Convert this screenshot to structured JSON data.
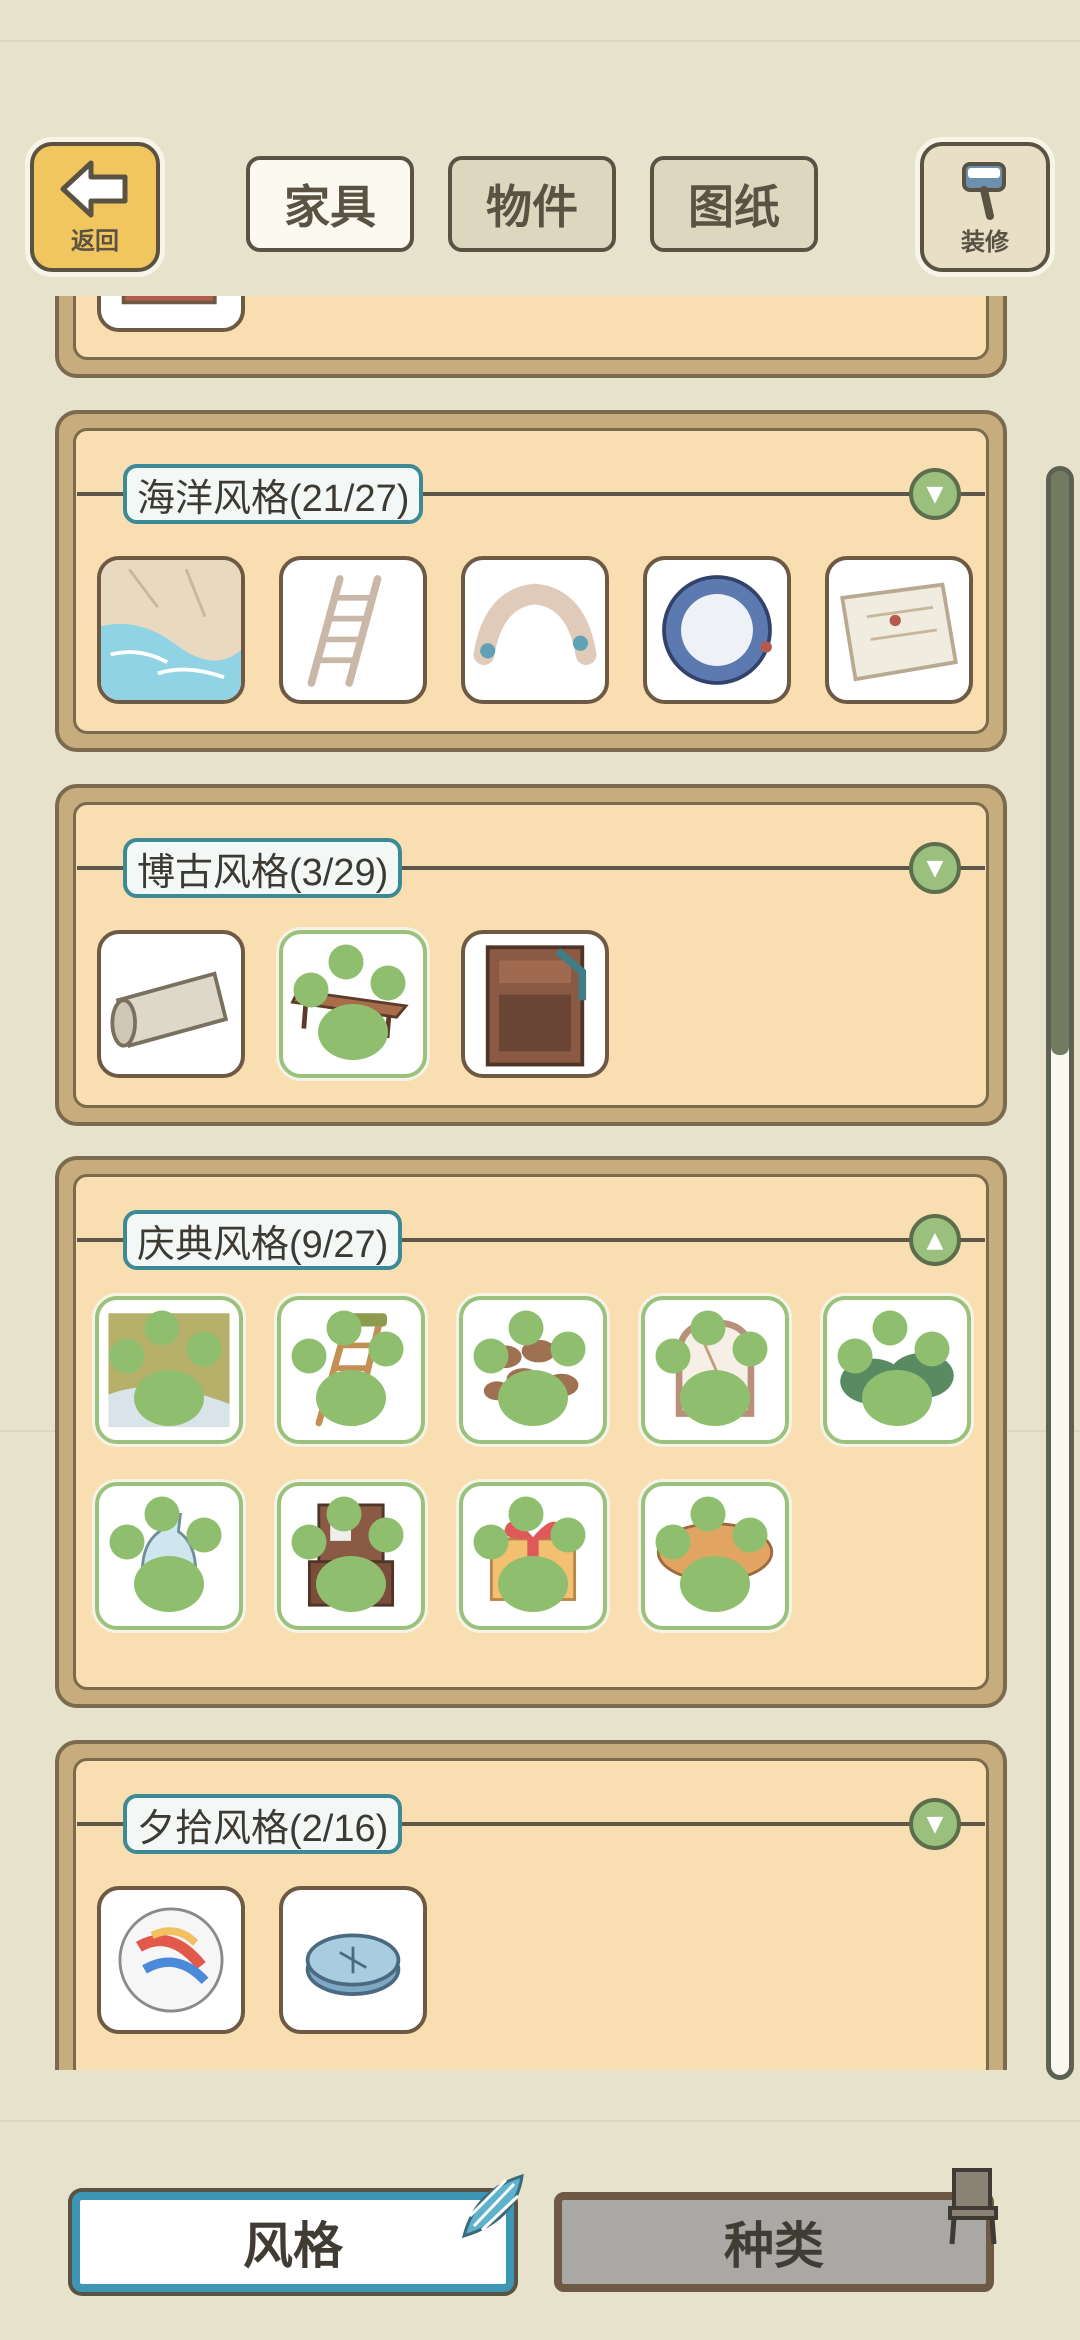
{
  "header": {
    "back_label": "返回",
    "decorate_label": "装修",
    "tabs": [
      {
        "label": "家具",
        "active": true
      },
      {
        "label": "物件",
        "active": false
      },
      {
        "label": "图纸",
        "active": false
      }
    ]
  },
  "categories": [
    {
      "title": "海洋风格(21/27)",
      "expanded": false,
      "items": [
        {
          "icon": "ocean-pool-icon",
          "owned": false
        },
        {
          "icon": "ladder-icon",
          "owned": false
        },
        {
          "icon": "rock-arch-icon",
          "owned": false
        },
        {
          "icon": "porthole-icon",
          "owned": false
        },
        {
          "icon": "map-icon",
          "owned": false
        }
      ]
    },
    {
      "title": "博古风格(3/29)",
      "expanded": false,
      "items": [
        {
          "icon": "scroll-icon",
          "owned": false
        },
        {
          "icon": "low-table-icon",
          "owned": true
        },
        {
          "icon": "cabinet-icon",
          "owned": false
        }
      ]
    },
    {
      "title": "庆典风格(9/27)",
      "expanded": true,
      "items": [
        {
          "icon": "wallpaper-icon",
          "owned": true
        },
        {
          "icon": "wooden-ladder-icon",
          "owned": true
        },
        {
          "icon": "stools-icon",
          "owned": true
        },
        {
          "icon": "arched-window-icon",
          "owned": true
        },
        {
          "icon": "cloth-bag-icon",
          "owned": true
        },
        {
          "icon": "vase-icon",
          "owned": true
        },
        {
          "icon": "fireplace-icon",
          "owned": true
        },
        {
          "icon": "gift-box-icon",
          "owned": true
        },
        {
          "icon": "mushroom-table-icon",
          "owned": true
        }
      ]
    },
    {
      "title": "夕拾风格(2/16)",
      "expanded": false,
      "items": [
        {
          "icon": "marble-icon",
          "owned": false
        },
        {
          "icon": "compass-icon",
          "owned": false
        }
      ]
    }
  ],
  "bottom_tabs": [
    {
      "label": "风格",
      "active": true
    },
    {
      "label": "种类",
      "active": false
    }
  ],
  "colors": {
    "background": "#e6e2cc",
    "panel": "#f8deb0",
    "owned_border": "#9bc27c",
    "accent_blue": "#3d97b4"
  }
}
